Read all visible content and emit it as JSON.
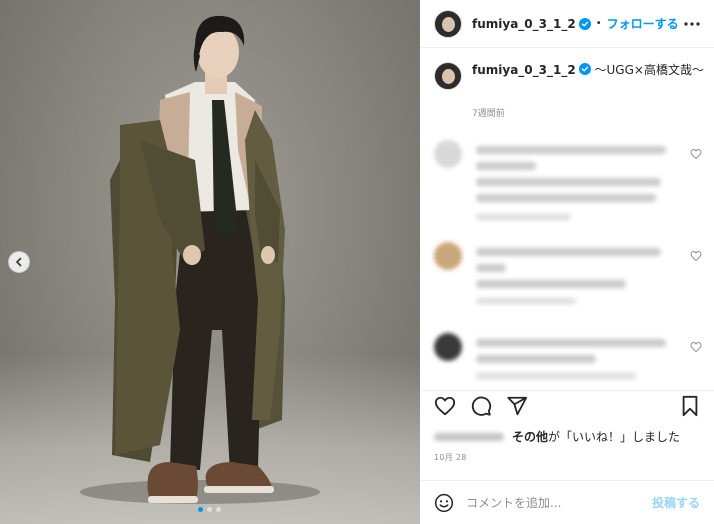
{
  "header": {
    "username": "fumiya_0_3_1_2",
    "separator": "•",
    "follow_label": "フォローする"
  },
  "caption": {
    "username": "fumiya_0_3_1_2",
    "text": " 〜UGG×高橋文哉〜",
    "time_ago": "7週間前"
  },
  "likes": {
    "suffix_bold": "その他",
    "suffix_text": "が「いいね！」しました"
  },
  "post_date": "10月 28",
  "comment_input": {
    "placeholder": "コメントを追加...",
    "post_label": "投稿する"
  },
  "icons": {
    "verified": "verified-badge-icon",
    "more": "more-options-icon",
    "like": "heart-icon",
    "comment": "comment-icon",
    "share": "share-icon",
    "save": "bookmark-icon",
    "emoji": "emoji-icon",
    "prev": "chevron-left-icon"
  },
  "colors": {
    "accent": "#0095f6",
    "text": "#262626",
    "muted": "#8e8e8e"
  }
}
